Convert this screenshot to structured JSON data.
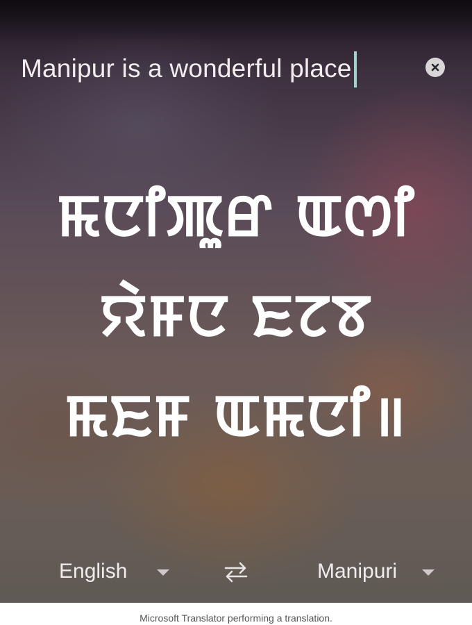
{
  "input": {
    "text": "Manipur is a wonderful place.",
    "clear_icon": "close-circle-icon"
  },
  "translation": {
    "line1": "ꯃꯅꯤꯄꯨꯔ ꯑꯁꯤ",
    "line2": "ꯌꯥꯝꯅ ꯐꯖꯕ",
    "line3": "ꯃꯐꯝ ꯑꯃꯅꯤ॥"
  },
  "languages": {
    "source": "English",
    "target": "Manipuri",
    "swap_icon": "swap-arrows-icon",
    "dropdown_icon": "caret-down-icon"
  },
  "caption": "Microsoft Translator performing a translation.",
  "colors": {
    "cursor": "#9fd3cc",
    "text": "#ffffff"
  }
}
